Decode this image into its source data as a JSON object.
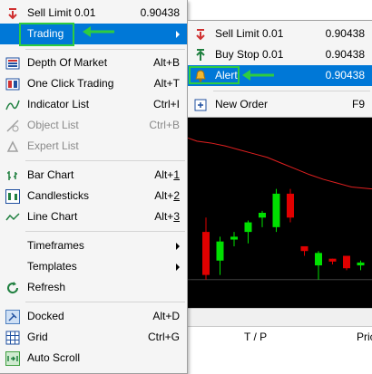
{
  "main_menu": {
    "items": [
      {
        "label": "Sell Limit 0.01",
        "shortcut": "0.90438",
        "icon": "sell-limit-icon"
      },
      {
        "label": "Trading",
        "icon": "none",
        "submenu": true
      },
      {
        "label": "Depth Of Market",
        "shortcut": "Alt+B",
        "icon": "depth-of-market-icon"
      },
      {
        "label": "One Click Trading",
        "shortcut": "Alt+T",
        "icon": "one-click-trading-icon"
      },
      {
        "label": "Indicator List",
        "shortcut": "Ctrl+I",
        "icon": "indicator-list-icon"
      },
      {
        "label": "Object List",
        "shortcut": "Ctrl+B",
        "icon": "object-list-icon",
        "disabled": true
      },
      {
        "label": "Expert List",
        "shortcut": "",
        "icon": "expert-list-icon",
        "disabled": true
      },
      {
        "label": "Bar Chart",
        "shortcut_prefix": "Alt+",
        "shortcut_key": "1",
        "icon": "bar-chart-icon"
      },
      {
        "label": "Candlesticks",
        "shortcut_prefix": "Alt+",
        "shortcut_key": "2",
        "icon": "candlesticks-icon"
      },
      {
        "label": "Line Chart",
        "shortcut_prefix": "Alt+",
        "shortcut_key": "3",
        "icon": "line-chart-icon"
      },
      {
        "label": "Timeframes",
        "submenu": true
      },
      {
        "label": "Templates",
        "submenu": true
      },
      {
        "label": "Refresh",
        "icon": "refresh-icon"
      },
      {
        "label": "Docked",
        "shortcut": "Alt+D",
        "icon": "docked-icon"
      },
      {
        "label": "Grid",
        "shortcut": "Ctrl+G",
        "icon": "grid-icon"
      },
      {
        "label": "Auto Scroll",
        "icon": "auto-scroll-icon"
      }
    ]
  },
  "sub_menu": {
    "items": [
      {
        "label": "Sell Limit 0.01",
        "shortcut": "0.90438",
        "icon": "sell-limit-icon"
      },
      {
        "label": "Buy Stop 0.01",
        "shortcut": "0.90438",
        "icon": "buy-stop-icon"
      },
      {
        "label": "Alert",
        "shortcut": "0.90438",
        "icon": "alert-bell-icon"
      },
      {
        "label": "New Order",
        "shortcut": "F9",
        "icon": "new-order-icon"
      }
    ]
  },
  "bottom_table": {
    "col_tp": "T / P",
    "col_price": "Pric"
  },
  "colors": {
    "highlight": "#0078d7",
    "annotation_green": "#2ecc40",
    "candle_up": "#00e000",
    "candle_down": "#e00000",
    "chart_bg": "#000000"
  },
  "chart_data": {
    "type": "candlestick",
    "candles": [
      {
        "o": 5,
        "h": 6.5,
        "l": 0,
        "c": 0.5
      },
      {
        "o": 2,
        "h": 4.5,
        "l": 0.5,
        "c": 4
      },
      {
        "o": 4.2,
        "h": 5,
        "l": 3.5,
        "c": 4.5
      },
      {
        "o": 5,
        "h": 6.2,
        "l": 3.8,
        "c": 6
      },
      {
        "o": 6.5,
        "h": 7.2,
        "l": 5.5,
        "c": 7
      },
      {
        "o": 5.5,
        "h": 9.5,
        "l": 5,
        "c": 9
      },
      {
        "o": 9,
        "h": 9.5,
        "l": 6,
        "c": 6.5
      },
      {
        "o": 3.5,
        "h": 3.5,
        "l": 2.5,
        "c": 3
      },
      {
        "o": 1.5,
        "h": 3,
        "l": 0,
        "c": 2.8
      },
      {
        "o": 2.2,
        "h": 2.2,
        "l": 1.6,
        "c": 1.9
      },
      {
        "o": 2.5,
        "h": 2.5,
        "l": 1,
        "c": 1.2
      },
      {
        "o": 1.5,
        "h": 2,
        "l": 1,
        "c": 1.8
      }
    ],
    "ma": [
      14.5,
      14.3,
      14.0,
      13.6,
      13.2,
      12.8,
      12.2,
      11.6,
      11.0,
      10.5,
      10.1,
      9.7
    ]
  }
}
